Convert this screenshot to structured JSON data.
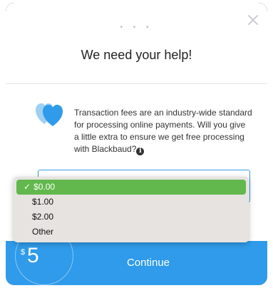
{
  "header": {
    "progress_dots": "• • •",
    "title": "We need your help!"
  },
  "icons": {
    "close": "close-icon",
    "hearts": "hearts-icon",
    "info": "info-icon"
  },
  "message": {
    "text": "Transaction fees are an industry-wide standard for processing online payments. Will you give a little extra to ensure we get free processing with Blackbaud?"
  },
  "dropdown": {
    "selected_index": 0,
    "check_mark": "✓",
    "options": [
      "$0.00",
      "$1.00",
      "$2.00",
      "Other"
    ]
  },
  "footer": {
    "currency_symbol": "$",
    "amount": "5",
    "continue_label": "Continue"
  },
  "colors": {
    "accent": "#2f9bea",
    "selected_option": "#62b84c",
    "focus_border": "#3a9be0",
    "heart_dark": "#2f9bea",
    "heart_light": "#9fd0f3"
  }
}
